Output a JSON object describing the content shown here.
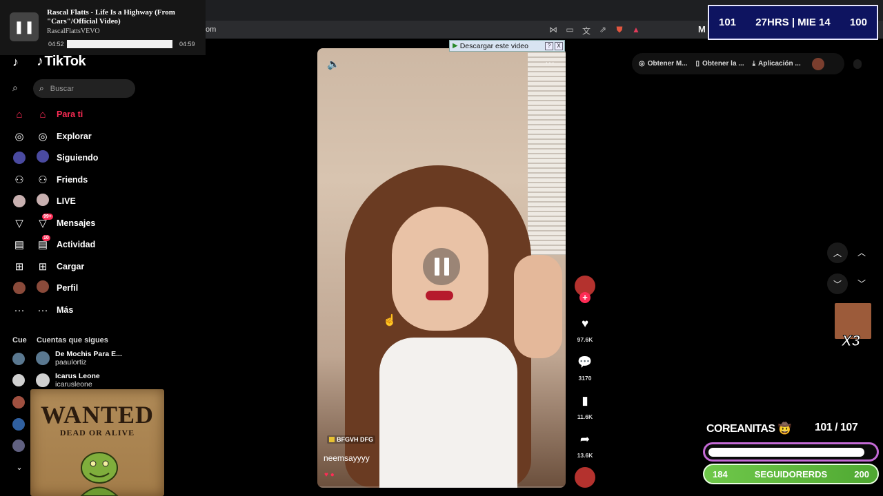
{
  "browser": {
    "url_fragment": "om"
  },
  "media": {
    "title": "Rascal Flatts - Life Is a Highway (From \"Cars\"/Official Video)",
    "artist": "RascalFlattsVEVO",
    "current_time": "04:52",
    "total_time": "04:59",
    "progress": 0.977
  },
  "stream_stats": {
    "left": "101",
    "center": "27HRS | MIE 14",
    "right": "100"
  },
  "tiktok": {
    "logo": "TikTok",
    "search_placeholder": "Buscar",
    "nav": [
      {
        "label": "Para ti",
        "icon": "home-icon"
      },
      {
        "label": "Explorar",
        "icon": "compass-icon"
      },
      {
        "label": "Siguiendo",
        "icon": "following-icon"
      },
      {
        "label": "Friends",
        "icon": "friends-icon"
      },
      {
        "label": "LIVE",
        "icon": "live-icon"
      },
      {
        "label": "Mensajes",
        "icon": "messages-icon",
        "badge": "99+"
      },
      {
        "label": "Actividad",
        "icon": "activity-icon",
        "badge": "10"
      },
      {
        "label": "Cargar",
        "icon": "upload-icon"
      },
      {
        "label": "Perfil",
        "icon": "profile-icon"
      },
      {
        "label": "Más",
        "icon": "more-icon"
      }
    ],
    "following_section_mini": "Cue",
    "following_section": "Cuentas que sigues",
    "accounts": [
      {
        "name": "De Mochis Para E...",
        "handle": "paaulortiz"
      },
      {
        "name": "Icarus Leone",
        "handle": "icarusleone"
      }
    ]
  },
  "wanted": {
    "title": "WANTED",
    "subtitle": "DEAD OR ALIVE"
  },
  "video": {
    "download_label": "Descargar este video",
    "help": "?",
    "close": "X",
    "tag": "BFGVH DFG",
    "username": "neemsayyyy",
    "likes": "97.6K",
    "comments": "3170",
    "saves": "11.6K",
    "shares": "13.6K"
  },
  "top_pills": [
    {
      "label": "Obtener M...",
      "icon": "coin-icon"
    },
    {
      "label": "Obtener la ...",
      "icon": "phone-icon"
    },
    {
      "label": "Aplicación ...",
      "icon": "download-icon"
    }
  ],
  "overlay": {
    "x3": "X3",
    "goal_title": "COREANITAS 🤠",
    "goal_count": "101  /  107",
    "goal_progress": 0.944,
    "followers_left": "184",
    "followers_label": "SEGUIDORERDS",
    "followers_right": "200"
  },
  "colors": {
    "accent": "#fe2c55",
    "stat_bg": "#0e1460",
    "goal_green": "#5fba3c",
    "goal_border": "#c46ad6"
  }
}
